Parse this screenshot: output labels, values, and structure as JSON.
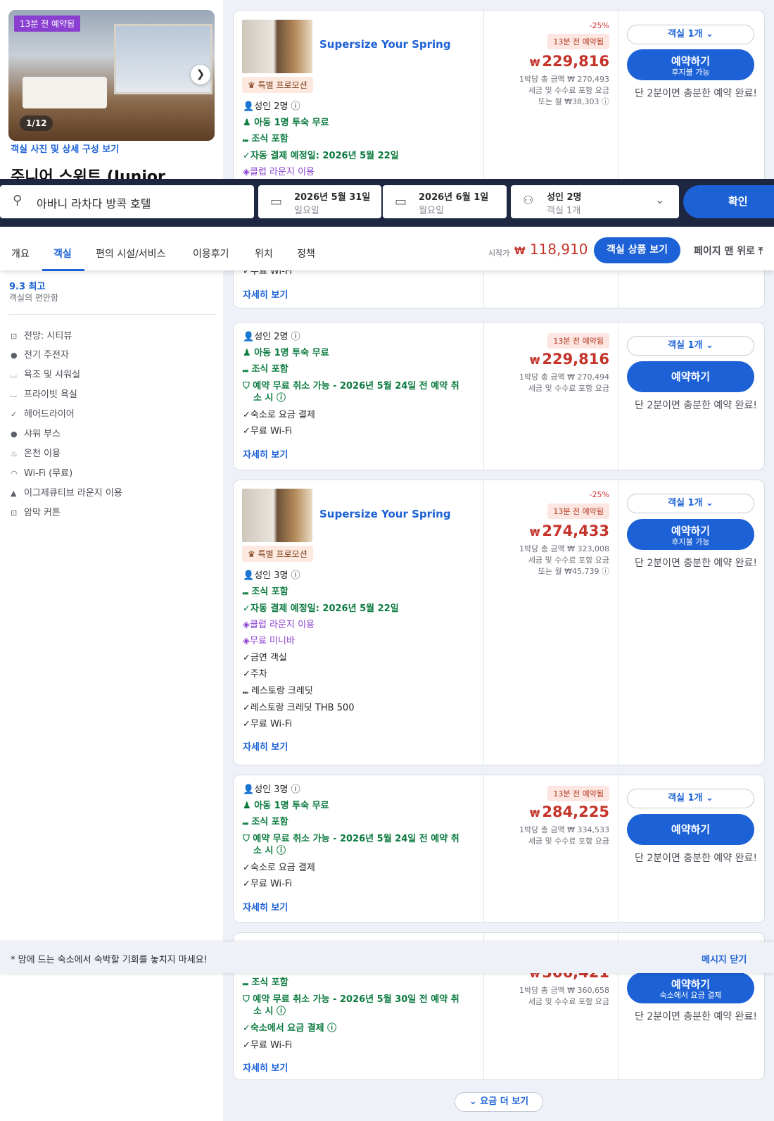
{
  "left_panel": {
    "photo_badge": "13분 전 예약됨",
    "photo_counter": "1/12",
    "photo_link": "객실 사진 및 상세 구성 보기",
    "room_name": "주니어 스위트 (Junior",
    "rating": "9.3 최고",
    "rating_sub": "객실의 편안함",
    "amenities": [
      {
        "icon": "view-icon",
        "label": "전망: 시티뷰"
      },
      {
        "icon": "kettle-icon",
        "label": "전기 주전자"
      },
      {
        "icon": "bathtub-icon",
        "label": "욕조 및 샤워실"
      },
      {
        "icon": "bathtub-icon",
        "label": "프라이빗 욕실"
      },
      {
        "icon": "check-icon",
        "label": "헤어드라이어"
      },
      {
        "icon": "shower-icon",
        "label": "샤워 부스"
      },
      {
        "icon": "hot-spring-icon",
        "label": "온천 이용"
      },
      {
        "icon": "wifi-icon",
        "label": "Wi-Fi (무료)"
      },
      {
        "icon": "lounge-icon",
        "label": "이그제큐티브 라운지 이용"
      },
      {
        "icon": "curtain-icon",
        "label": "암막 커튼"
      }
    ]
  },
  "search": {
    "hotel": "아바니 라차다 방콕 호텔",
    "checkin_date": "2026년 5월 31일",
    "checkin_day": "일요일",
    "checkout_date": "2026년 6월 1일",
    "checkout_day": "월요일",
    "guests": "성인 2명",
    "rooms": "객실 1개",
    "confirm": "확인"
  },
  "nav": {
    "tabs": [
      "개요",
      "객실",
      "편의 시설/서비스",
      "이용후기",
      "위치",
      "정책"
    ],
    "from_label": "시작가",
    "currency": "₩",
    "from_price": "118,910",
    "view_rooms": "객실 상품 보기",
    "back_to_top": "페이지 맨 위로"
  },
  "common": {
    "more": "자세히 보기",
    "room_select": "객실 1개",
    "book": "예약하기",
    "hurry": "단 2분이면 충분한 예약 완료!",
    "currency": "₩",
    "promo_title": "Supersize Your Spring",
    "promo_badge": "특별 프로모션",
    "booked": "13분 전 예약됨",
    "discount": "-25%",
    "tax_note": "세금 및 수수료 포함 요금"
  },
  "card1": {
    "features": [
      "성인 2명",
      "아동 1명 투숙 무료",
      "조식 포함",
      "자동 결제 예정일: 2026년 5월 22일",
      "클럽 라운지 이용"
    ],
    "price": "229,816",
    "total": "1박당 총 금액 ₩ 270,493",
    "monthly": "또는 월 ₩38,303",
    "book_sub": "후지불 가능",
    "tail_feature": "무료 Wi-Fi"
  },
  "card2": {
    "features": [
      "성인 2명",
      "아동 1명 투숙 무료",
      "조식 포함",
      "예약 무료 취소 가능 - 2026년 5월 24일 전 예약 취",
      "소 시",
      "숙소로 요금 결제",
      "무료 Wi-Fi"
    ],
    "price": "229,816",
    "total": "1박당 총 금액 ₩ 270,494"
  },
  "card3": {
    "features": [
      "성인 3명",
      "조식 포함",
      "자동 결제 예정일: 2026년 5월 22일",
      "클럽 라운지 이용",
      "무료 미니바",
      "금연 객실",
      "주차",
      "레스토랑 크레딧",
      "레스토랑 크레딧 THB 500",
      "무료 Wi-Fi"
    ],
    "price": "274,433",
    "total": "1박당 총 금액 ₩ 323,008",
    "monthly": "또는 월 ₩45,739",
    "book_sub": "후지불 가능"
  },
  "card4": {
    "features": [
      "성인 3명",
      "아동 1명 투숙 무료",
      "조식 포함",
      "예약 무료 취소 가능 - 2026년 5월 24일 전 예약 취",
      "소 시",
      "숙소로 요금 결제",
      "무료 Wi-Fi"
    ],
    "price": "284,225",
    "total": "1박당 총 금액 ₩ 334,533"
  },
  "card5": {
    "features": [
      "조식 포함",
      "예약 무료 취소 가능 - 2026년 5월 30일 전 예약 취",
      "소 시",
      "숙소에서 요금 결제",
      "무료 Wi-Fi"
    ],
    "price": "306,421",
    "total": "1박당 총 금액 ₩ 360,658",
    "book_sub": "숙소에서 요금 결제"
  },
  "message": {
    "text": "* 맘에 드는 숙소에서 숙박할 기회를 놓치지 마세요!",
    "close": "메시지 닫기"
  },
  "more_rates": "요금 더 보기"
}
